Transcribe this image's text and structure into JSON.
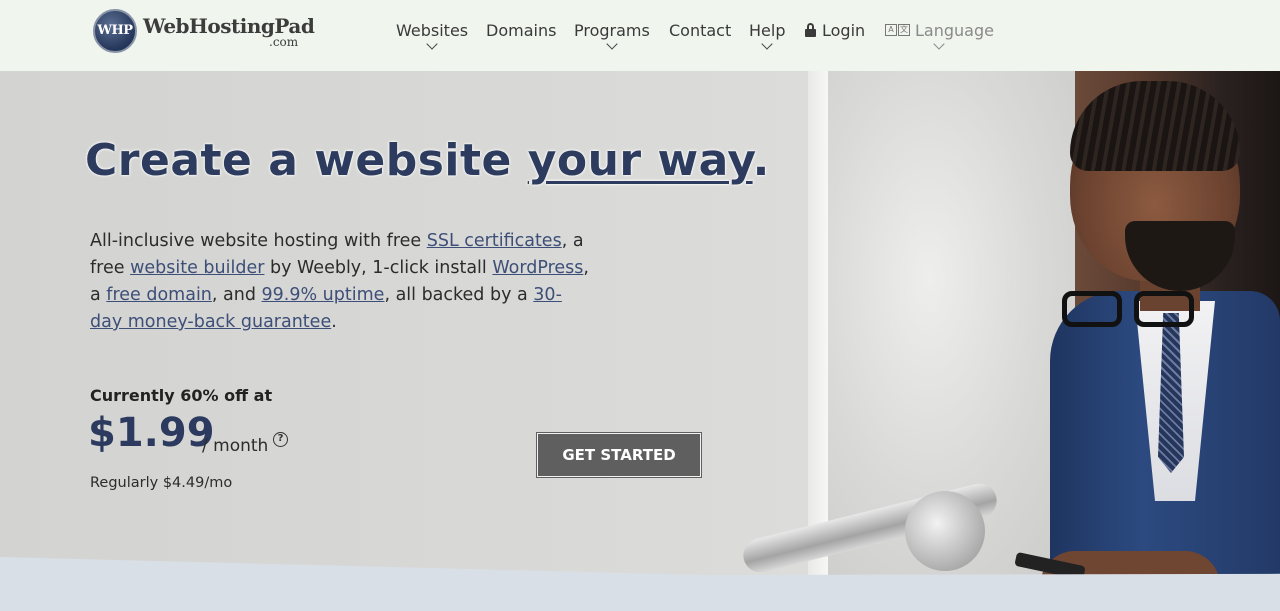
{
  "header": {
    "logo": {
      "mark": "WHP",
      "name": "WebHostingPad",
      "suffix": ".com"
    },
    "nav": [
      {
        "label": "Websites"
      },
      {
        "label": "Domains"
      },
      {
        "label": "Programs"
      },
      {
        "label": "Contact"
      },
      {
        "label": "Help"
      },
      {
        "label": "Login",
        "icon": "lock-icon"
      },
      {
        "label": "Language",
        "icon": "translate-icon"
      }
    ]
  },
  "hero": {
    "headline_start": "Create a website ",
    "headline_emph": "your way",
    "headline_end": ".",
    "desc": {
      "t1": "All-inclusive website hosting with free ",
      "l1": "SSL certificates",
      "t2": ", a free ",
      "l2": "website builder",
      "t3": " by Weebly, 1-click install ",
      "l3": "WordPress",
      "t4": ", a ",
      "l4": "free domain",
      "t5": ", and ",
      "l5": "99.9% uptime",
      "t6": ", all backed by a ",
      "l6": "30-day money-back guarantee",
      "t7": "."
    },
    "promo": "Currently 60% off at",
    "price": "$1.99",
    "per": "/ month",
    "help_glyph": "?",
    "regular": "Regularly $4.49/mo",
    "cta": "GET STARTED"
  },
  "colors": {
    "header_bg": "#f0f5ee",
    "headline": "#2d3c5e",
    "link": "#3d4f78",
    "cta_bg": "#5f5f5f"
  }
}
